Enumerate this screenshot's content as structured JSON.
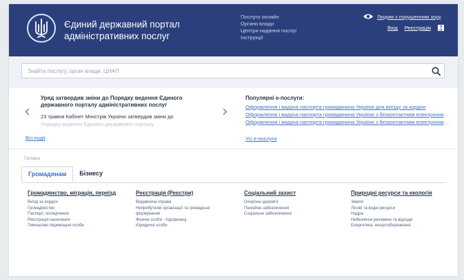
{
  "header": {
    "title": "Єдиний державний портал адміністративних послуг",
    "nav": [
      "Послуги онлайн",
      "Органи влади",
      "Центри надання послуг",
      "Інструкції"
    ],
    "accessibility_label": "Людям з порушенням зору",
    "login": "Вхід",
    "register": "Реєстрація",
    "help_glyph": "?"
  },
  "search": {
    "placeholder": "Знайти послугу, орган влади, ЦНАП"
  },
  "news": {
    "prev_glyph": "‹",
    "next_glyph": "›",
    "title": "Уряд затвердив зміни до Порядку ведення Єдиного державного порталу адміністративних послуг",
    "description": "23 травня Кабінет Міністрів України затвердив зміни до",
    "faded": "Порядку ведення Єдиного державного порталу",
    "all_events": "Всі події"
  },
  "popular": {
    "heading": "Популярні е-послуги:",
    "items": [
      "Оформлення і видача паспорта громадянина України для виїзду за кордон",
      "Оформлення і видача паспорта громадянина України з безконтактним електронним носієм",
      "Оформлення і видача паспорта громадянина України з безконтактним електронним носієм"
    ],
    "all_services": "Усі е-послуги"
  },
  "breadcrumb": "Головна",
  "tabs": [
    "Громадянам",
    "Бізнесу"
  ],
  "categories": [
    {
      "title": "Громадянство, міграція, переїзд",
      "items": [
        "Виїзд за кордон",
        "Громадянство",
        "Паспорт, посвідчення",
        "Реєстрація населення",
        "Тимчасово переміщені особи"
      ]
    },
    {
      "title": "Реєстрація (Реєстри)",
      "items": [
        "Видавнича справа",
        "Неприбуткові організації та громадські",
        "формування",
        "Фізичні особи - підприємці",
        "Юридичні особи"
      ]
    },
    {
      "title": "Соціальний захист",
      "items": [
        "Охорона здоров'я",
        "Пенсійне забезпечення",
        "Соціальне забезпечення"
      ]
    },
    {
      "title": "Природні ресурси та екологія",
      "items": [
        "Земля",
        "Лісові та водні ресурси",
        "Надра",
        "Небезпечні речовини та відходи",
        "Енергетика, енергозбереження"
      ]
    }
  ]
}
